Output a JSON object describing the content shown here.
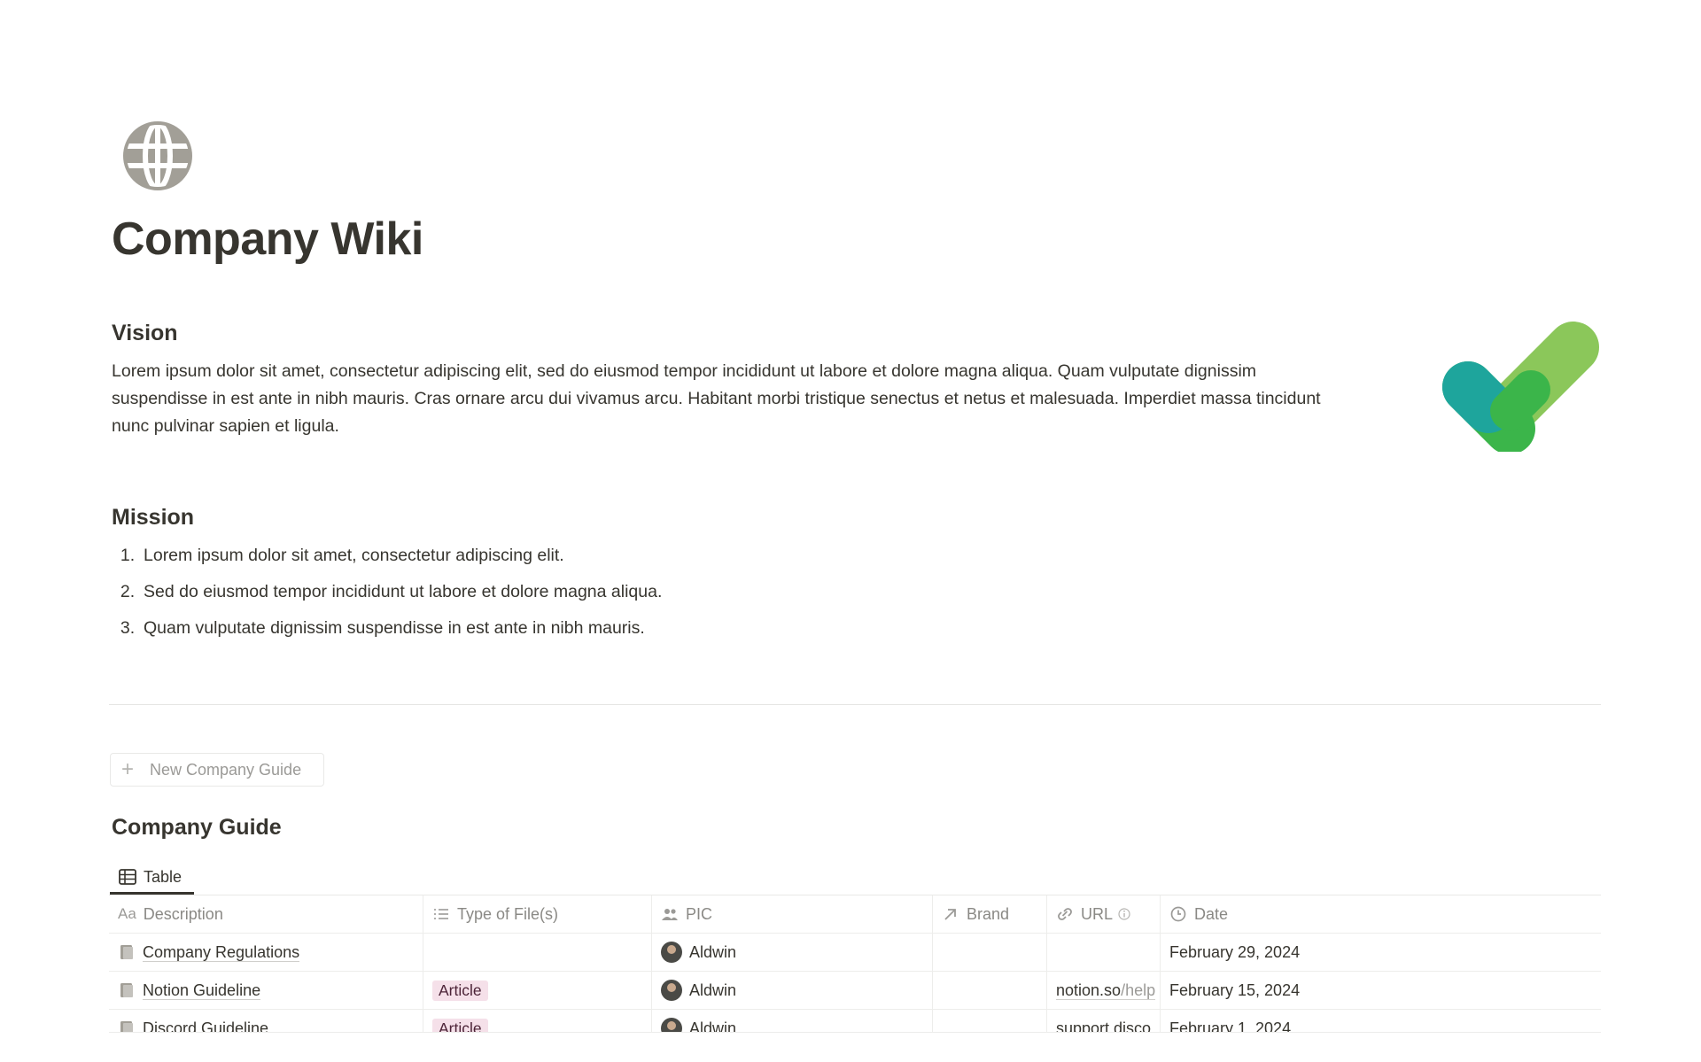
{
  "page": {
    "title": "Company Wiki",
    "icon": "globe-icon"
  },
  "vision": {
    "heading": "Vision",
    "text": "Lorem ipsum dolor sit amet, consectetur adipiscing elit, sed do eiusmod tempor incididunt ut labore et dolore magna aliqua. Quam vulputate dignissim suspendisse in est ante in nibh mauris. Cras ornare arcu dui vivamus arcu. Habitant morbi tristique senectus et netus et malesuada. Imperdiet massa tincidunt nunc pulvinar sapien et ligula."
  },
  "mission": {
    "heading": "Mission",
    "items": [
      {
        "num": "1.",
        "text": "Lorem ipsum dolor sit amet, consectetur adipiscing elit."
      },
      {
        "num": "2.",
        "text": "Sed do eiusmod tempor incididunt ut labore et dolore magna aliqua."
      },
      {
        "num": "3.",
        "text": "Quam vulputate dignissim suspendisse in est ante in nibh mauris."
      }
    ]
  },
  "guide": {
    "new_button": "New Company Guide",
    "title": "Company Guide",
    "view_tab": "Table",
    "columns": {
      "description": "Description",
      "type": "Type of File(s)",
      "pic": "PIC",
      "brand": "Brand",
      "url": "URL",
      "date": "Date"
    },
    "rows": [
      {
        "description": "Company Regulations",
        "type": "",
        "pic": "Aldwin",
        "brand": "",
        "url": "",
        "url_dim": "",
        "date": "February 29, 2024"
      },
      {
        "description": "Notion Guideline",
        "type": "Article",
        "pic": "Aldwin",
        "brand": "",
        "url": "notion.so",
        "url_dim": "/help",
        "date": "February 15, 2024"
      },
      {
        "description": "Discord Guideline",
        "type": "Article",
        "pic": "Aldwin",
        "brand": "",
        "url": "support.disco",
        "url_dim": "",
        "date": "February 1, 2024"
      }
    ]
  },
  "colors": {
    "text": "#37352f",
    "muted": "#9b9a97",
    "tag_bg": "#f5e0e9",
    "globe": "#a29f97",
    "check_teal": "#1ea59c",
    "check_green": "#3bb54a",
    "check_light": "#8bc75a"
  }
}
